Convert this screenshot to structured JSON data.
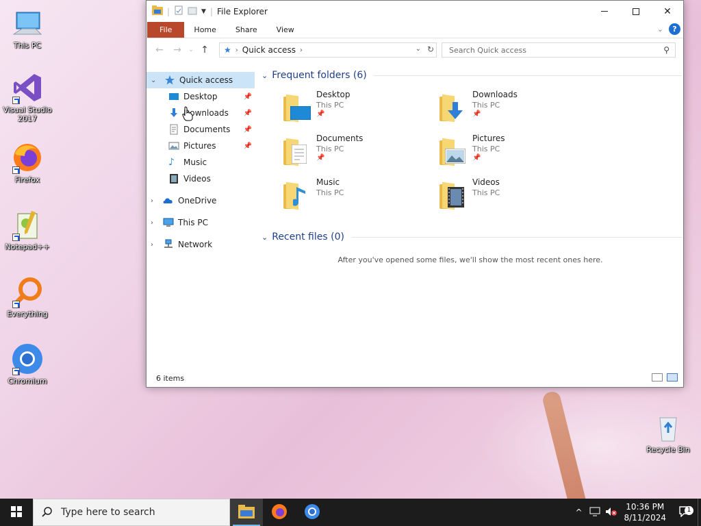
{
  "desktop": {
    "icons": [
      {
        "label": "This PC"
      },
      {
        "label": "Visual Studio 2017"
      },
      {
        "label": "Firefox"
      },
      {
        "label": "Notepad++"
      },
      {
        "label": "Everything"
      },
      {
        "label": "Chromium"
      },
      {
        "label": "Recycle Bin"
      }
    ]
  },
  "window": {
    "title": "File Explorer",
    "ribbon_tabs": [
      "File",
      "Home",
      "Share",
      "View"
    ],
    "address": {
      "crumb": "Quick access"
    },
    "search": {
      "placeholder": "Search Quick access"
    },
    "nav": {
      "quick_access": "Quick access",
      "pinned": [
        "Desktop",
        "Downloads",
        "Documents",
        "Pictures"
      ],
      "unpinned": [
        "Music",
        "Videos"
      ],
      "roots": [
        "OneDrive",
        "This PC",
        "Network"
      ]
    },
    "frequent_header": "Frequent folders (6)",
    "folders": [
      {
        "name": "Desktop",
        "location": "This PC",
        "pinned": true
      },
      {
        "name": "Downloads",
        "location": "This PC",
        "pinned": true
      },
      {
        "name": "Documents",
        "location": "This PC",
        "pinned": true
      },
      {
        "name": "Pictures",
        "location": "This PC",
        "pinned": true
      },
      {
        "name": "Music",
        "location": "This PC",
        "pinned": false
      },
      {
        "name": "Videos",
        "location": "This PC",
        "pinned": false
      }
    ],
    "recent_header": "Recent files (0)",
    "recent_empty": "After you've opened some files, we'll show the most recent ones here.",
    "status": "6 items"
  },
  "taskbar": {
    "search_placeholder": "Type here to search",
    "time": "10:36 PM",
    "date": "8/11/2024",
    "notification_count": "1"
  },
  "colors": {
    "file_tab": "#b9472c",
    "selection": "#cce4f7",
    "group_header": "#1e3f8a",
    "taskbar": "#1c1c1c"
  }
}
